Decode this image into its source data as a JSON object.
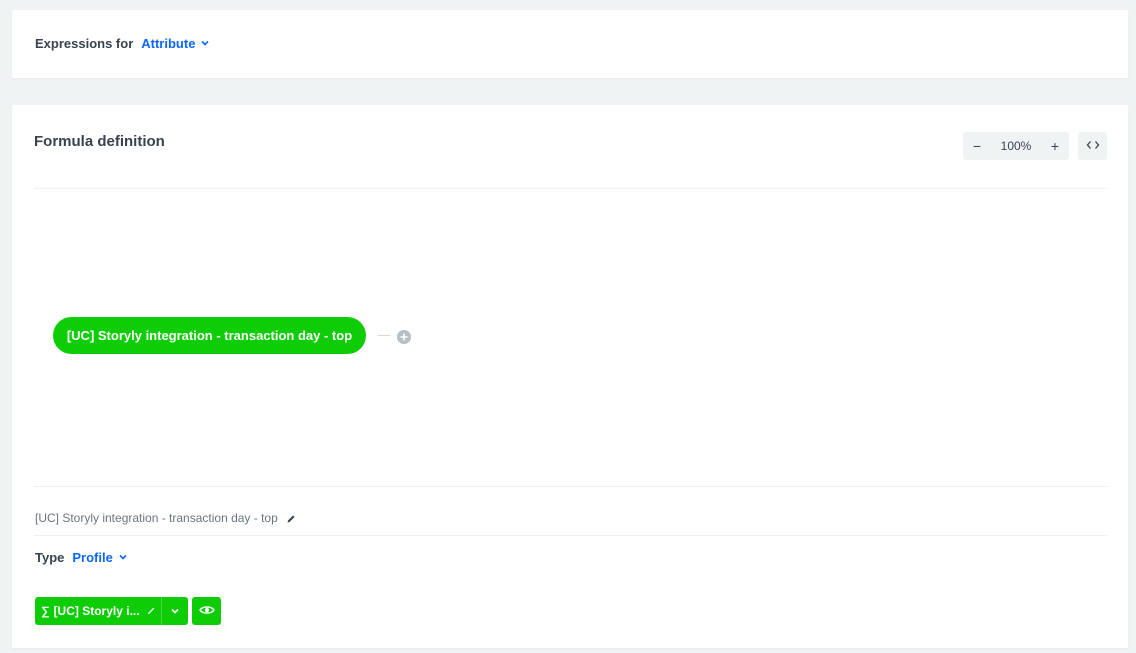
{
  "expressions": {
    "label": "Expressions for",
    "selected": "Attribute"
  },
  "formula": {
    "title": "Formula definition",
    "zoom": {
      "minus": "−",
      "value": "100%",
      "plus": "+"
    },
    "node_label": "[UC] Storyly integration - transaction day - top",
    "name": "[UC] Storyly integration - transaction day - top"
  },
  "type": {
    "label": "Type",
    "selected": "Profile"
  },
  "attribute_button": {
    "sigma": "∑",
    "label": "[UC] Storyly i..."
  },
  "colors": {
    "accent_green": "#0ecd06",
    "link_blue": "#0b68ff"
  },
  "icons": [
    "chevron-down-icon",
    "code-icon",
    "plus-circle-icon",
    "pencil-icon",
    "eye-icon"
  ]
}
